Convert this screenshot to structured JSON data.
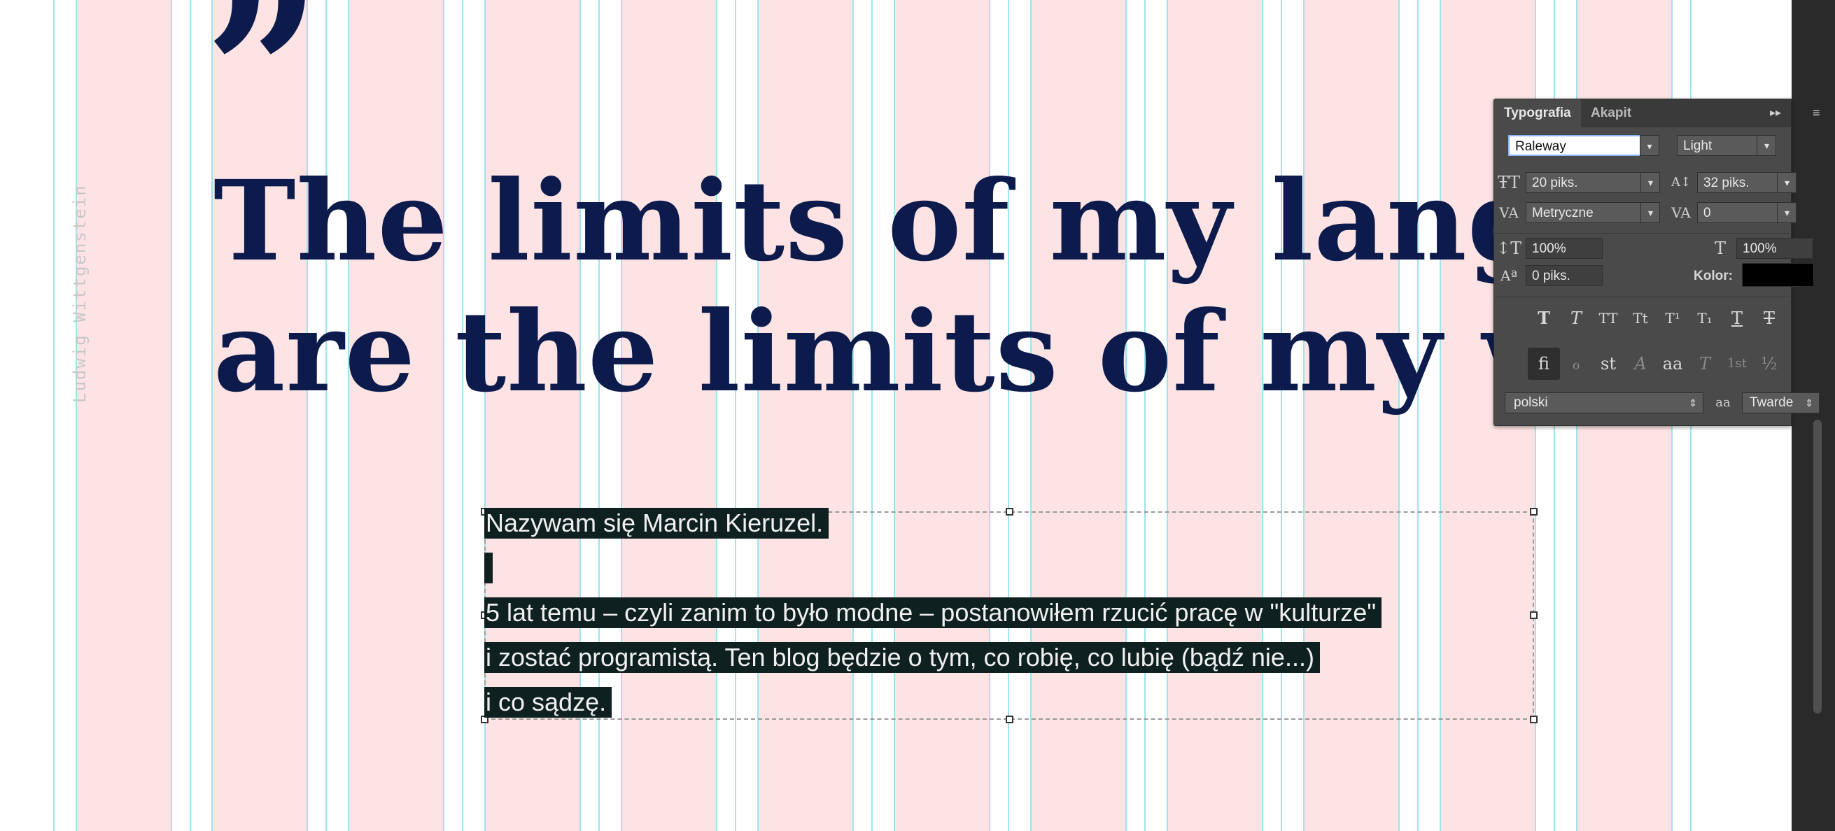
{
  "canvas": {
    "quote_mark": "”",
    "headline_line_1": "The limits of my languag",
    "headline_line_2": "are the limits of my worl",
    "author": "Ludwig Wittgenstein"
  },
  "textbox": {
    "lines": [
      "Nazywam się Marcin Kieruzel.",
      "5 lat temu – czyli zanim to było modne – postanowiłem rzucić pracę w \"kulturze\"",
      "i zostać programistą. Ten blog będzie o tym, co robię, co lubię (bądź nie...)",
      "i co sądzę."
    ]
  },
  "panel": {
    "tabs": [
      "Typografia",
      "Akapit"
    ],
    "active_tab": "Typografia",
    "font_family": "Raleway",
    "font_style": "Light",
    "font_size": "20 piks.",
    "leading": "32 piks.",
    "kerning": "Metryczne",
    "tracking": "0",
    "vertical_scale": "100%",
    "horizontal_scale": "100%",
    "baseline_shift": "0 piks.",
    "color_label": "Kolor:",
    "color_value": "#000000",
    "style_buttons": [
      "T",
      "T",
      "TT",
      "Tt",
      "T¹",
      "T₁",
      "T",
      "T"
    ],
    "opentype_buttons": [
      "fi",
      "ℴ",
      "st",
      "A",
      "aa",
      "T",
      "1st",
      "½"
    ],
    "language": "polski",
    "antialias_icon": "aa",
    "antialias": "Twarde"
  },
  "colors": {
    "column": "#fde3e4",
    "guide": "#9ee3ee",
    "headline": "#0d1b4c",
    "panel_bg": "#4a4a4a",
    "selection": "#0f2020"
  }
}
